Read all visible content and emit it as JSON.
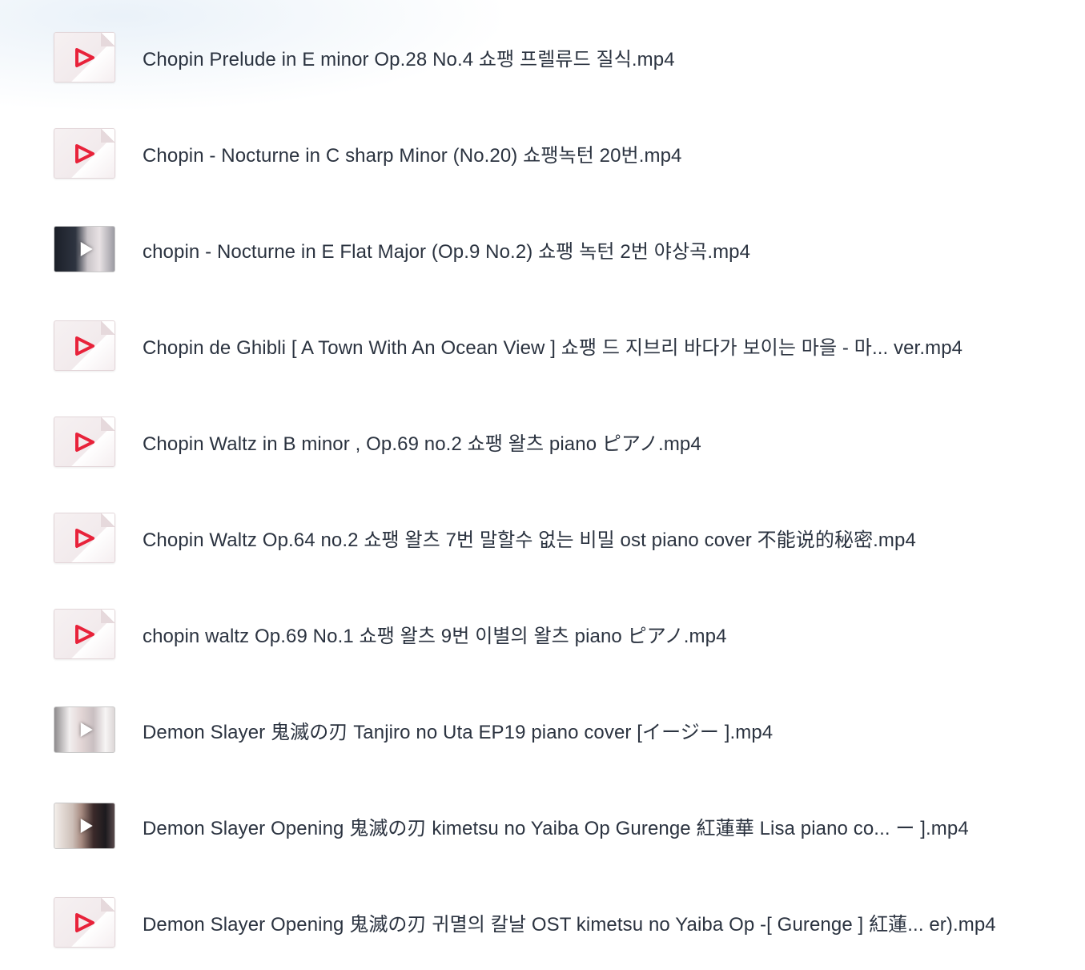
{
  "files": [
    {
      "name": "Chopin  Prelude in E minor Op.28 No.4    쇼팽 프렐류드  질식.mp4",
      "thumbnail": "generic-video-icon"
    },
    {
      "name": "Chopin - Nocturne in C sharp Minor (No.20) 쇼팽녹턴 20번.mp4",
      "thumbnail": "generic-video-icon"
    },
    {
      "name": "chopin - Nocturne in E Flat Major (Op.9 No.2) 쇼팽 녹턴 2번 야상곡.mp4",
      "thumbnail": "video-preview"
    },
    {
      "name": "Chopin de Ghibli [ A Town With An Ocean View ] 쇼팽 드 지브리   바다가 보이는 마을 - 마...   ver.mp4",
      "thumbnail": "generic-video-icon"
    },
    {
      "name": "Chopin Waltz in B minor , Op.69 no.2   쇼팽 왈츠 piano ピアノ.mp4",
      "thumbnail": "generic-video-icon"
    },
    {
      "name": "Chopin Waltz Op.64 no.2 쇼팽 왈츠 7번   말할수 없는 비밀 ost piano cover 不能说的秘密.mp4",
      "thumbnail": "generic-video-icon"
    },
    {
      "name": "chopin waltz Op.69 No.1 쇼팽 왈츠 9번   이별의 왈츠 piano ピアノ.mp4",
      "thumbnail": "generic-video-icon"
    },
    {
      "name": "Demon Slayer 鬼滅の刃  Tanjiro no Uta EP19   piano cover [イージー ].mp4",
      "thumbnail": "video-preview"
    },
    {
      "name": "Demon Slayer Opening 鬼滅の刃  kimetsu no Yaiba Op   Gurenge  紅蓮華    Lisa piano co...  ー ].mp4",
      "thumbnail": "video-preview"
    },
    {
      "name": "Demon Slayer Opening 鬼滅の刃 귀멸의 칼날 OST  kimetsu no Yaiba Op -[ Gurenge ] 紅蓮...  er).mp4",
      "thumbnail": "generic-video-icon"
    }
  ],
  "colors": {
    "play_icon": "#e8223a",
    "text": "#2b3340"
  }
}
